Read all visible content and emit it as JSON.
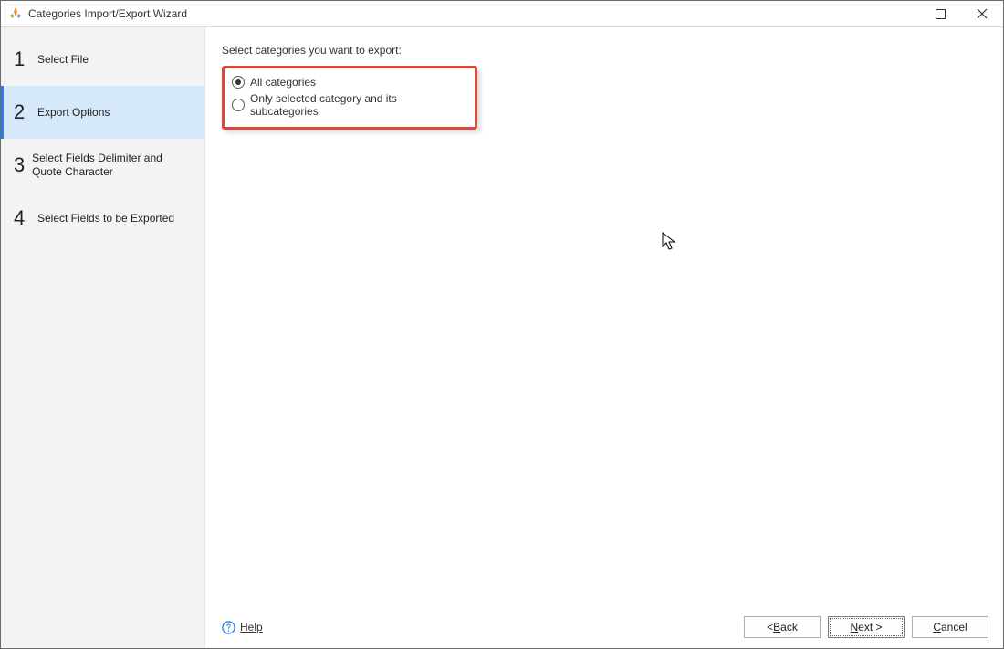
{
  "window": {
    "title": "Categories Import/Export Wizard",
    "icon": "app-icon"
  },
  "sidebar": {
    "steps": [
      {
        "num": "1",
        "label": "Select File",
        "selected": false
      },
      {
        "num": "2",
        "label": "Export Options",
        "selected": true
      },
      {
        "num": "3",
        "label": "Select Fields Delimiter and Quote Character",
        "selected": false
      },
      {
        "num": "4",
        "label": "Select Fields to be Exported",
        "selected": false
      }
    ]
  },
  "content": {
    "prompt": "Select categories you want to export:",
    "radios": [
      {
        "label": "All categories",
        "checked": true
      },
      {
        "label": "Only selected category and its subcategories",
        "checked": false
      }
    ],
    "highlight_box": true
  },
  "footer": {
    "help": "Help",
    "back_prefix": "< ",
    "back_mn": "B",
    "back_suffix": "ack",
    "next_mn": "N",
    "next_suffix": "ext >",
    "cancel_mn": "C",
    "cancel_suffix": "ancel"
  },
  "cursor": {
    "visible": true
  }
}
